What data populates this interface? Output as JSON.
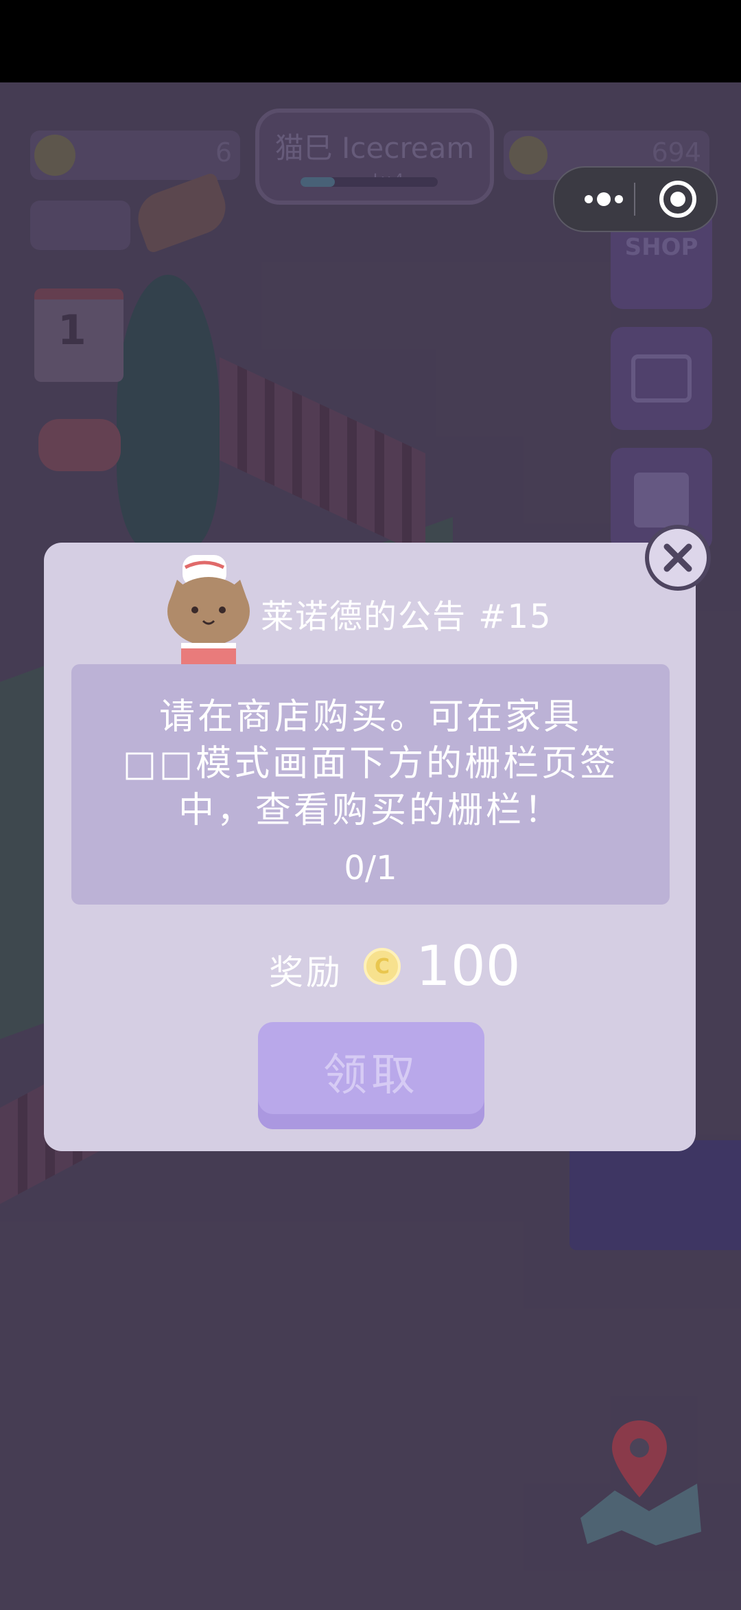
{
  "hud": {
    "left_count": "6",
    "title": "猫巳 Icecream",
    "level": "Lv.4",
    "coins": "694",
    "level_progress": 0.25
  },
  "side": {
    "shop_label": "SHOP"
  },
  "calendar": {
    "day": "1"
  },
  "dialog": {
    "title": "莱诺德的公告 #15",
    "task_lines": [
      "请在商店购买。可在家具",
      "□□模式画面下方的栅栏页签",
      "中，查看购买的栅栏！"
    ],
    "progress": "0/1",
    "reward_label": "奖励",
    "coin_symbol": "C",
    "reward_value": "100",
    "claim_label": "领取"
  },
  "colors": {
    "dialog_bg": "#d5cee3",
    "task_box": "#bcb2d6",
    "claim_button": "#b9a8ea",
    "coin": "#f7e18e"
  },
  "icons": [
    "more-dots-icon",
    "target-icon",
    "close-icon",
    "shop-icon",
    "chest-icon",
    "shirt-icon",
    "map-pin-icon",
    "calendar-icon",
    "gamepad-icon"
  ]
}
